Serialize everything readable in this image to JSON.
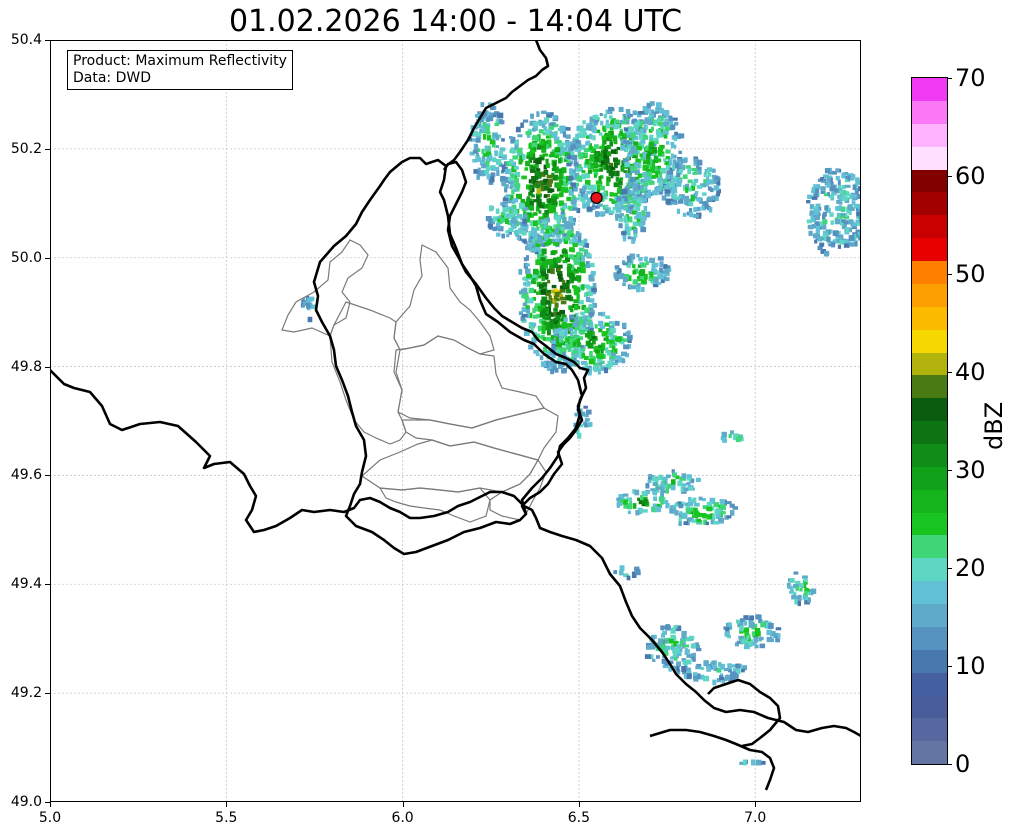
{
  "title": "01.02.2026 14:00 - 14:04 UTC",
  "info_box": {
    "line1": "Product: Maximum Reflectivity",
    "line2": "Data: DWD"
  },
  "map": {
    "lon_range": [
      5.0,
      7.3
    ],
    "lat_range": [
      49.0,
      50.4
    ],
    "x_ticks": [
      "5.0",
      "5.5",
      "6.0",
      "6.5",
      "7.0"
    ],
    "y_ticks": [
      "50.4",
      "50.2",
      "50.0",
      "49.8",
      "49.6",
      "49.4",
      "49.2",
      "49.0"
    ],
    "grid": "dashed light gray",
    "marker": {
      "lon": 6.55,
      "lat": 50.11,
      "color": "#e8101a"
    }
  },
  "colorbar": {
    "label": "dBZ",
    "ticks": [
      "70",
      "60",
      "50",
      "40",
      "30",
      "20",
      "10",
      "0"
    ],
    "range": [
      0,
      70
    ],
    "colors": [
      "#6475a4",
      "#56689f",
      "#4a5d9b",
      "#4460a0",
      "#4878ad",
      "#5592c0",
      "#5fa9c9",
      "#62c0d6",
      "#5dd6c4",
      "#3ed677",
      "#18c520",
      "#16b41c",
      "#11a219",
      "#0f8d16",
      "#0d7512",
      "#0a5c0e",
      "#497a14",
      "#b2b40d",
      "#f6d700",
      "#fdbb00",
      "#fd9f00",
      "#fe8000",
      "#e60000",
      "#c80000",
      "#a20000",
      "#820000",
      "#ffe0ff",
      "#ffb2ff",
      "#fb79f7",
      "#f03af1"
    ]
  }
}
